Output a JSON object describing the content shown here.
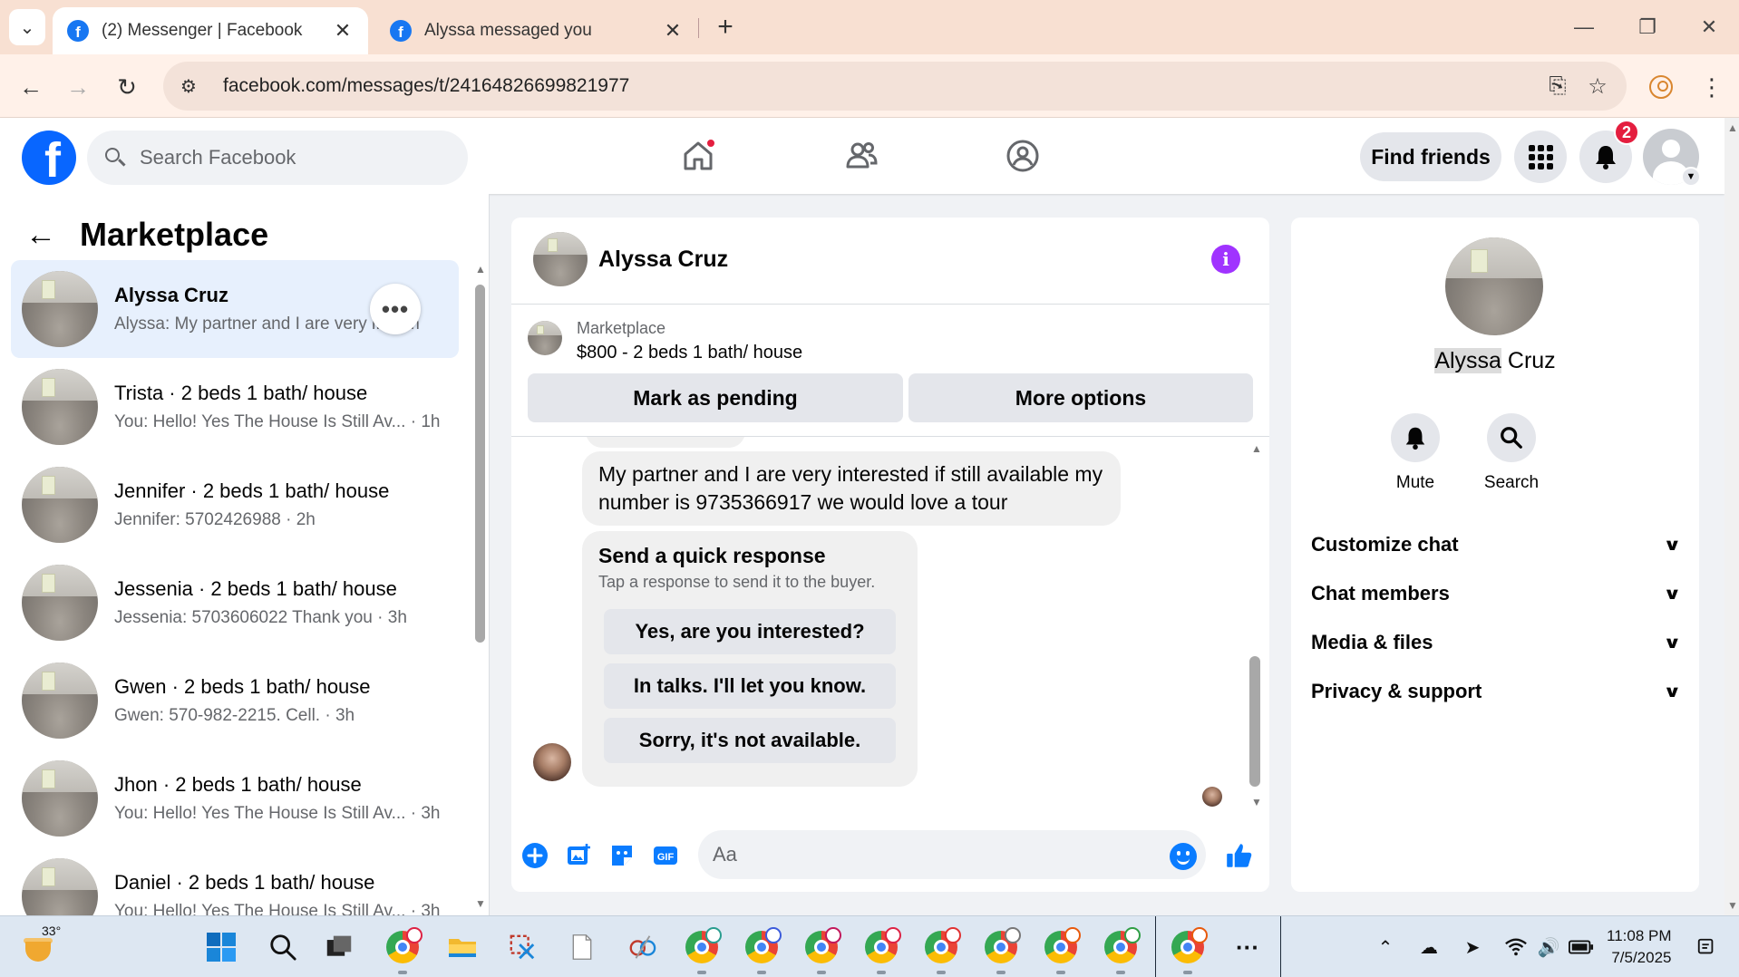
{
  "browser": {
    "tabs": [
      {
        "title": "(2) Messenger | Facebook",
        "active": true
      },
      {
        "title": "Alyssa messaged you",
        "active": false
      }
    ],
    "url": "facebook.com/messages/t/24164826699821977"
  },
  "fb_header": {
    "logo_letter": "f",
    "search_placeholder": "Search Facebook",
    "find_friends_label": "Find friends",
    "notification_count": "2",
    "brand_color": "#0866ff"
  },
  "left_panel": {
    "title": "Marketplace",
    "more_label": "•••",
    "conversations": [
      {
        "name": "Alyssa Cruz",
        "snippet": "Alyssa: My partner and I are very i...·1m",
        "selected": true
      },
      {
        "name": "Trista · 2 beds 1 bath/ house",
        "snippet": "You: Hello! Yes The House Is Still Av... · 1h"
      },
      {
        "name": "Jennifer · 2 beds 1 bath/ house",
        "snippet": "Jennifer: 5702426988 · 2h"
      },
      {
        "name": "Jessenia · 2 beds 1 bath/ house",
        "snippet": "Jessenia: 5703606022 Thank you · 3h"
      },
      {
        "name": "Gwen · 2 beds 1 bath/ house",
        "snippet": "Gwen: 570-982-2215. Cell. · 3h"
      },
      {
        "name": "Jhon · 2 beds 1 bath/ house",
        "snippet": "You: Hello! Yes The House Is Still Av... · 3h"
      },
      {
        "name": "Daniel · 2 beds 1 bath/ house",
        "snippet": "You: Hello! Yes The House Is Still Av... · 3h"
      }
    ]
  },
  "chat": {
    "contact_name": "Alyssa Cruz",
    "listing": {
      "label": "Marketplace",
      "title": "$800 - 2 beds 1 bath/ house",
      "mark_pending": "Mark as pending",
      "more_options": "More options"
    },
    "message": "My partner and I are very interested if still available my number is 9735366917 we would love a tour",
    "quick_response": {
      "title": "Send a quick response",
      "subtitle": "Tap a response to send it to the buyer.",
      "options": [
        "Yes, are you interested?",
        "In talks. I'll let you know.",
        "Sorry, it's not available."
      ]
    },
    "composer_placeholder": "Aa",
    "accent_color": "#0a7cff"
  },
  "right_panel": {
    "name_first": "Alyssa",
    "name_last": " Cruz",
    "actions": [
      {
        "label": "Mute",
        "icon": "bell-icon"
      },
      {
        "label": "Search",
        "icon": "search-icon"
      }
    ],
    "sections": [
      "Customize chat",
      "Chat members",
      "Media & files",
      "Privacy & support"
    ]
  },
  "taskbar": {
    "temperature": "33°",
    "time": "11:08 PM",
    "date": "7/5/2025"
  }
}
